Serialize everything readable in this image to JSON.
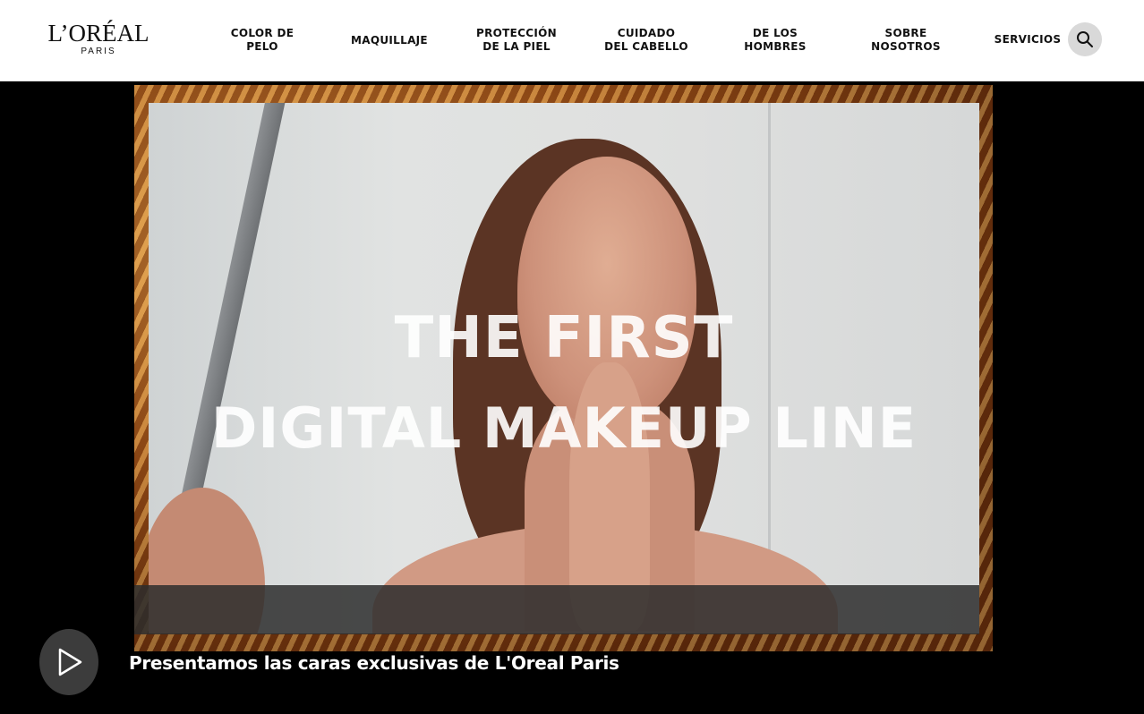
{
  "brand": {
    "name": "L’ORÉAL",
    "sub": "PARIS"
  },
  "nav": {
    "items": [
      {
        "label": "COLOR DE\nPELO"
      },
      {
        "label": "MAQUILLAJE"
      },
      {
        "label": "PROTECCIÓN\nDE LA PIEL"
      },
      {
        "label": "CUIDADO\nDEL CABELLO"
      },
      {
        "label": "DE LOS\nHOMBRES"
      },
      {
        "label": "SOBRE\nNOSOTROS"
      },
      {
        "label": "SERVICIOS"
      }
    ],
    "search_icon": "search-icon"
  },
  "video": {
    "headline_line1": "THE FIRST",
    "headline_line2": "DIGITAL MAKEUP LINE",
    "title": "Presentamos las caras exclusivas de L'Oreal Paris",
    "play_icon": "play-icon"
  },
  "colors": {
    "header_bg": "#ffffff",
    "page_bg": "#000000",
    "accent_gold": "#c47a2c",
    "search_bg": "#d9d9d9"
  }
}
